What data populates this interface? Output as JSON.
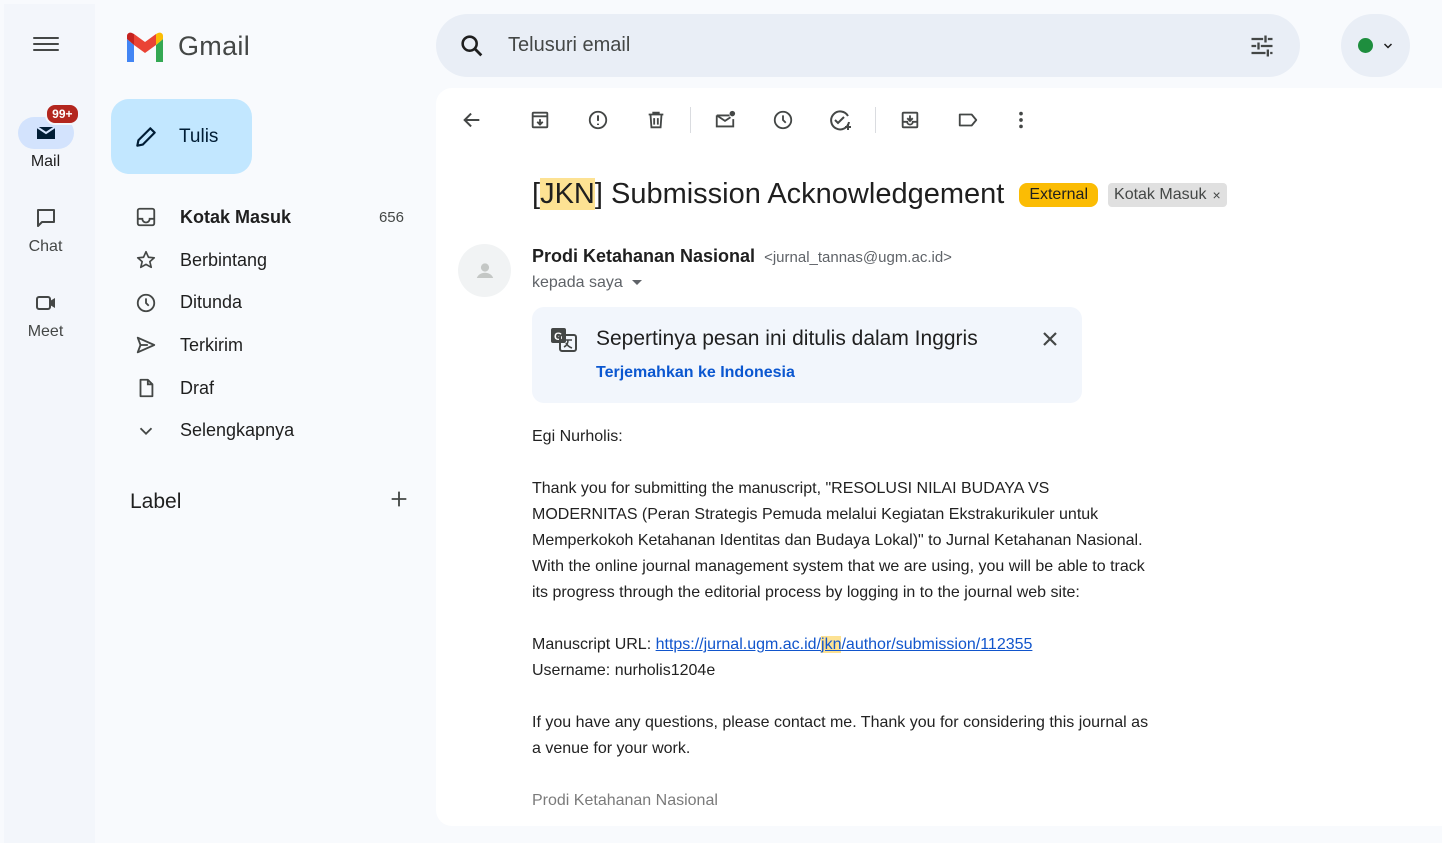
{
  "rail": {
    "items": [
      {
        "label": "Mail",
        "badge": "99+"
      },
      {
        "label": "Chat"
      },
      {
        "label": "Meet"
      }
    ]
  },
  "brand": {
    "name": "Gmail"
  },
  "compose": {
    "label": "Tulis"
  },
  "nav": {
    "items": [
      {
        "label": "Kotak Masuk",
        "count": "656",
        "icon": "inbox-icon"
      },
      {
        "label": "Berbintang",
        "icon": "star-icon"
      },
      {
        "label": "Ditunda",
        "icon": "clock-icon"
      },
      {
        "label": "Terkirim",
        "icon": "send-icon"
      },
      {
        "label": "Draf",
        "icon": "draft-icon"
      },
      {
        "label": "Selengkapnya",
        "icon": "chevron-down-icon"
      }
    ]
  },
  "labels": {
    "title": "Label"
  },
  "search": {
    "placeholder": "Telusuri email"
  },
  "email": {
    "subject_tag": "JKN",
    "subject_rest": "] Submission Acknowledgement",
    "subject_open": "[",
    "chips": {
      "external": "External",
      "inbox": "Kotak Masuk",
      "inbox_remove": "×"
    },
    "sender_name": "Prodi Ketahanan Nasional",
    "sender_email": "<jurnal_tannas@ugm.ac.id>",
    "to": "kepada saya",
    "translate": {
      "message": "Sepertinya pesan ini ditulis dalam Inggris",
      "action": "Terjemahkan ke Indonesia"
    },
    "greeting": "Egi Nurholis:",
    "para1": "Thank you for submitting the manuscript, \"RESOLUSI NILAI BUDAYA VS MODERNITAS (Peran Strategis Pemuda melalui Kegiatan Ekstrakurikuler untuk Memperkokoh Ketahanan Identitas dan Budaya Lokal)\" to Jurnal Ketahanan Nasional. With the online journal management system that we are using, you will be able to track its progress through the editorial process by logging in to the journal web site:",
    "url_label": "Manuscript URL: ",
    "url_pre": "https://jurnal.ugm.ac.id/",
    "url_hl": "jkn",
    "url_post": "/author/submission/112355",
    "username_line": "Username: nurholis1204e",
    "para3": "If you have any questions, please contact me. Thank you for considering this journal as a venue for your work.",
    "signature": "Prodi Ketahanan Nasional"
  },
  "colors": {
    "accent": "#0b57d0",
    "compose_bg": "#c2e7ff",
    "badge": "#b3261e",
    "external_chip": "#fbbc04",
    "highlight": "#fde293"
  }
}
